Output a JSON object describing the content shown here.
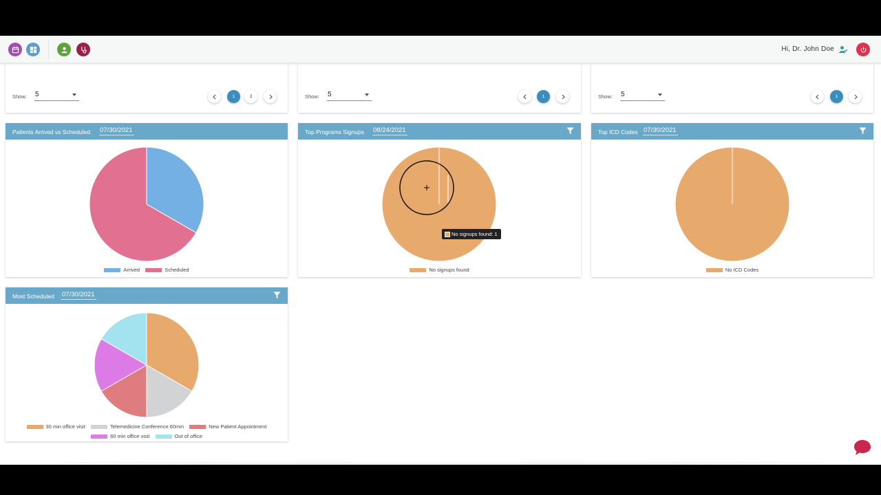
{
  "colors": {
    "header_blue": "#6aa8c9",
    "page_active": "#3d8dbc",
    "arrived": "#74b0e4",
    "scheduled": "#e27091",
    "orange": "#e8a96c",
    "gray": "#d1d3d5",
    "red_salmon": "#df7c7f",
    "magenta": "#dd7be6",
    "cyan": "#a3e3f0"
  },
  "topbar": {
    "icons": [
      "calendar-icon",
      "dashboard-icon",
      "user-badge-icon",
      "stethoscope-icon",
      "user-check-icon",
      "power-icon"
    ],
    "greeting": "Hi, Dr. John Doe"
  },
  "pager_cards": [
    {
      "show_label": "Show:",
      "show_value": "5",
      "pages": [
        "1",
        "2"
      ],
      "active_page": "1"
    },
    {
      "show_label": "Show:",
      "show_value": "5",
      "pages": [
        "1"
      ],
      "active_page": "1"
    },
    {
      "show_label": "Show:",
      "show_value": "5",
      "pages": [
        "1"
      ],
      "active_page": "1"
    }
  ],
  "charts": {
    "patients": {
      "title": "Patients Arrived vs Scheduled",
      "date": "07/30/2021",
      "legend": [
        "Arrived",
        "Scheduled"
      ]
    },
    "programs": {
      "title": "Top Programs Signups",
      "date": "08/24/2021",
      "legend": [
        "No signups found"
      ],
      "tooltip": "No signups found: 1"
    },
    "icd": {
      "title": "Top ICD Codes",
      "date": "07/30/2021",
      "legend": [
        "No ICD Codes"
      ]
    },
    "most": {
      "title": "Most Scheduled",
      "date": "07/30/2021",
      "legend": [
        "30 min office visit",
        "Telemedicine Conference 60min",
        "New Patient Appointment",
        "60 min office visit",
        "Out of office"
      ]
    }
  },
  "chart_data": [
    {
      "type": "pie",
      "title": "Patients Arrived vs Scheduled",
      "categories": [
        "Arrived",
        "Scheduled"
      ],
      "values": [
        1,
        2
      ]
    },
    {
      "type": "pie",
      "title": "Top Programs Signups",
      "categories": [
        "No signups found"
      ],
      "values": [
        1
      ]
    },
    {
      "type": "pie",
      "title": "Top ICD Codes",
      "categories": [
        "No ICD Codes"
      ],
      "values": [
        1
      ]
    },
    {
      "type": "pie",
      "title": "Most Scheduled",
      "categories": [
        "30 min office visit",
        "Telemedicine Conference 60min",
        "New Patient Appointment",
        "60 min office visit",
        "Out of office"
      ],
      "values": [
        2,
        1,
        1,
        1,
        1
      ]
    }
  ]
}
